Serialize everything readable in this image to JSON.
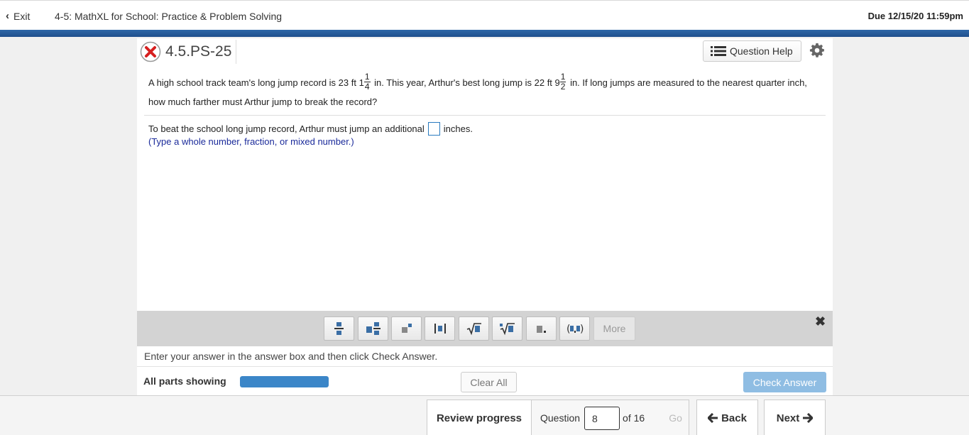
{
  "header": {
    "exit_label": "Exit",
    "assignment_title": "4-5: MathXL for School: Practice & Problem Solving",
    "due": "Due 12/15/20 11:59pm"
  },
  "question": {
    "id": "4.5.PS-25",
    "help_label": "Question Help",
    "text_part1": "A high school track team's long jump record is 23 ft 1",
    "frac1_num": "1",
    "frac1_den": "4",
    "text_part2": " in. This year, Arthur's best long jump is 22 ft 9",
    "frac2_num": "1",
    "frac2_den": "2",
    "text_part3": " in. If long jumps are measured to the nearest quarter inch, how much farther must Arthur jump to break the record?",
    "answer_prefix": "To beat the school long jump record, Arthur must jump an additional",
    "answer_suffix": "inches.",
    "hint": "(Type a whole number, fraction, or mixed number.)"
  },
  "math_toolbar": {
    "buttons": [
      "fraction-icon",
      "mixed-number-icon",
      "exponent-icon",
      "absolute-value-icon",
      "square-root-icon",
      "nth-root-icon",
      "decimal-icon",
      "ordered-pair-icon"
    ],
    "more_label": "More"
  },
  "instruction": "Enter your answer in the answer box and then click Check Answer.",
  "status": {
    "parts_label": "All parts showing",
    "progress": 1.0,
    "clear_label": "Clear All",
    "check_label": "Check Answer"
  },
  "nav": {
    "review_label": "Review progress",
    "question_label": "Question",
    "question_number": "8",
    "of_label": "of 16",
    "go_label": "Go",
    "back_label": "Back",
    "next_label": "Next"
  }
}
